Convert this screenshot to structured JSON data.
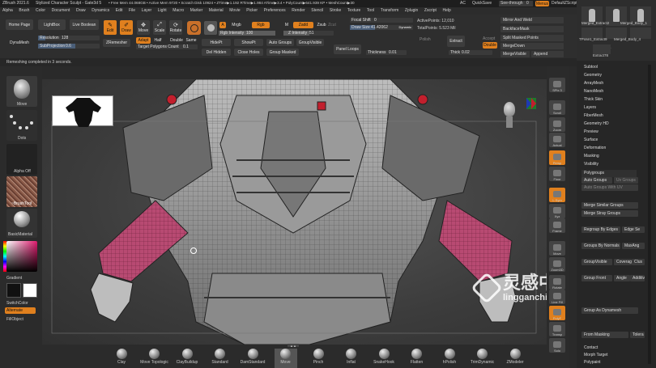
{
  "titlebar": {
    "app": "ZBrush 2021.6",
    "doc": "Stylized Character Sculpt - Gate3d 5",
    "stats": "• Free Mem 44.068GB • Active Mem 9720 • Scratch Disk 10924 • ZTime▶1.192 RTime▶1.984 ATime▶3.4 • PolyCount▶641.939 KP • MeshCount▶30",
    "ac": "AC",
    "quicksave": "QuickSave",
    "seethrough": "See-through",
    "seethrough_val": "0",
    "menus": "Menus",
    "defaultscript": "DefaultZScript"
  },
  "menubar": [
    "Alpha",
    "Brush",
    "Color",
    "Document",
    "Draw",
    "Dynamics",
    "Edit",
    "File",
    "Layer",
    "Light",
    "Macro",
    "Marker",
    "Material",
    "Movie",
    "Picker",
    "Preferences",
    "Render",
    "Stencil",
    "Stroke",
    "Texture",
    "Tool",
    "Transform",
    "Zplugin",
    "Zscript",
    "Help"
  ],
  "toolbar": {
    "home": "Home Page",
    "lightbox": "LightBox",
    "livebool": "Live Boolean",
    "edit": "Edit",
    "draw": "Draw",
    "move": "Move",
    "scale": "Scale",
    "rotate": "Rotate",
    "a": "A",
    "mrgb": "Mrgb",
    "rgb": "Rgb",
    "m": "M",
    "zadd": "Zadd",
    "zsub": "Zsub",
    "zcut": "Zcut",
    "rgb_intensity": "Rgb Intensity",
    "rgb_intensity_val": "100",
    "z_intensity": "Z Intensity",
    "z_intensity_val": "51",
    "focal_shift": "Focal Shift",
    "focal_shift_val": "0",
    "draw_size": "Draw Size",
    "draw_size_val": "41.42062",
    "dynamic": "Dynamic",
    "active_points": "ActivePoints: 12,010",
    "total_points": "TotalPoints: 5.523 Mil",
    "dynamesh": "DynaMesh",
    "resolution": "Resolution",
    "resolution_val": "128",
    "subprojection": "SubProjection",
    "subprojection_val": "0.6",
    "zremesher": "ZRemesher",
    "adapt": "Adapt",
    "half": "Half",
    "double": "Double",
    "same": "Same",
    "target_polys": "Target Polygons Count",
    "target_polys_val": "0.1",
    "hidept": "HidePt",
    "showpt": "ShowPt",
    "auto_groups": "Auto Groups",
    "group_visible": "GroupVisible",
    "del_hidden": "Del Hidden",
    "close_holes": "Close Holes",
    "group_masked": "Group Masked",
    "panel_loops": "Panel Loops",
    "thickness": "Thickness",
    "thickness_val": "0.01",
    "polish": "Polish",
    "extract": "Extract",
    "accept": "Accept",
    "thick": "Thick",
    "thick_val": "0.02",
    "double2": "Double",
    "mirror_weld": "Mirror And Weld",
    "backface_mask": "BackfaceMask",
    "split_masked": "Split Masked Points",
    "merge_down": "MergeDown",
    "merge_visible": "MergeVisible",
    "append": "Append"
  },
  "status": {
    "text": "Remeshing completed in 3 seconds."
  },
  "subtools": {
    "items": [
      "Merged_Extract2",
      "Merged_Body_1",
      "TPose1_Extract9",
      "Merged_Body_4",
      "Extract78"
    ],
    "counts": [
      "30",
      "58",
      "54"
    ]
  },
  "leftshelf": {
    "move": "Move",
    "dots": "Dots",
    "alpha_off": "Alpha Off",
    "brushtool": "~BrushTool",
    "basicmaterial": "BasicMaterial",
    "gradient": "Gradient",
    "switchcolor": "SwitchColor",
    "alternate": "Alternate",
    "fillobject": "FillObject"
  },
  "righttools": [
    "SPix 3",
    "Scroll",
    "Zoom",
    "Actual",
    "Persp",
    "Floor",
    "L.Sym",
    "Xyz",
    "Frame",
    "Move",
    "Zoom3D",
    "Rotate",
    "Line Fill",
    "PolyF",
    "Transp",
    "Solo"
  ],
  "rightpanel": {
    "tool_sections": [
      "Subtool",
      "Geometry",
      "ArrayMesh",
      "NanoMesh",
      "Thick Skin",
      "Layers",
      "FiberMesh",
      "Geometry HD",
      "Preview",
      "Surface",
      "Deformation",
      "Masking",
      "Visibility",
      "Polygroups"
    ],
    "auto_groups": "Auto Groups",
    "uv_groups": "Uv Groups",
    "auto_groups_uv": "Auto Groups With UV",
    "merge_similar": "Merge Similar Groups",
    "merge_stray": "Merge Stray Groups",
    "regroup_edges": "Regroup By Edges",
    "edge_sen": "Edge Se",
    "groups_normals": "Groups By Normals",
    "maxang": "MaxAng",
    "group_visible": "GroupVisible",
    "coverage": "Coverag",
    "clus": "Clus",
    "group_front": "Group Front",
    "angle": "Angle",
    "additive": "Additiv",
    "group_polypaint": "Group As Dynamesh",
    "from_masking": "From Masking",
    "tolerance": "Tolera",
    "contact": "Contact",
    "morph_target": "Morph Target",
    "polypaint": "Polypaint"
  },
  "brushes": [
    "Clay",
    "Move Topologic",
    "ClayBuildup",
    "Standard",
    "DamStandard",
    "Move",
    "Pinch",
    "Inflat",
    "SnakeHook",
    "Flatten",
    "hPolish",
    "TrimDynamic",
    "ZModeler"
  ],
  "watermark": {
    "brand": "灵感中国",
    "url": "lingganchina.com"
  },
  "colors": {
    "accent": "#e0801e",
    "panel": "#262626",
    "canvas": "#3f3f3f",
    "mesh_pink": "#b84a72"
  }
}
